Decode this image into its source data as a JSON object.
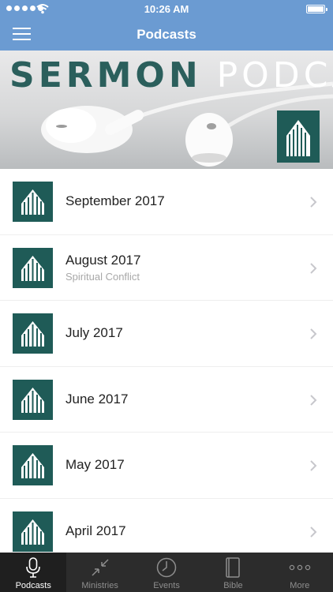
{
  "status_bar": {
    "time": "10:26 AM"
  },
  "nav": {
    "title": "Podcasts"
  },
  "banner": {
    "word1": "SERMON",
    "word2": "PODCAST"
  },
  "episodes": [
    {
      "title": "September 2017",
      "subtitle": ""
    },
    {
      "title": "August 2017",
      "subtitle": "Spiritual Conflict"
    },
    {
      "title": "July 2017",
      "subtitle": ""
    },
    {
      "title": "June 2017",
      "subtitle": ""
    },
    {
      "title": "May 2017",
      "subtitle": ""
    },
    {
      "title": "April 2017",
      "subtitle": ""
    }
  ],
  "tabs": [
    {
      "label": "Podcasts",
      "icon": "microphone-icon",
      "active": true
    },
    {
      "label": "Ministries",
      "icon": "compress-arrows-icon",
      "active": false
    },
    {
      "label": "Events",
      "icon": "clock-icon",
      "active": false
    },
    {
      "label": "Bible",
      "icon": "book-icon",
      "active": false
    },
    {
      "label": "More",
      "icon": "more-dots-icon",
      "active": false
    }
  ],
  "colors": {
    "nav": "#6b9bd2",
    "brand_teal": "#1f5b57",
    "tab_bar": "#2c2c2c"
  }
}
